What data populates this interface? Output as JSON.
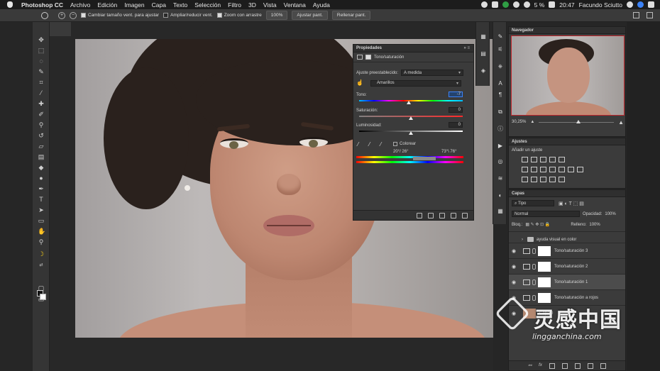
{
  "menubar": {
    "app_name": "Photoshop CC",
    "items": [
      "Archivo",
      "Edición",
      "Imagen",
      "Capa",
      "Texto",
      "Selección",
      "Filtro",
      "3D",
      "Vista",
      "Ventana",
      "Ayuda"
    ],
    "battery": "5 %",
    "time": "20:47",
    "user": "Facundo Sciutto"
  },
  "optionsbar": {
    "zoom_in": "+",
    "zoom_out": "−",
    "resize_windows": "Cambiar tamaño vent. para ajustar",
    "zoom_all_windows": "Ampliar/reducir vent.",
    "scrubby_zoom": "Zoom con arrastre",
    "percent_btn": "100%",
    "fit_btn": "Ajustar pant.",
    "fill_btn": "Rellenar pant."
  },
  "properties": {
    "title": "Propiedades",
    "panel_controls": "» ≡",
    "adjustment_name": "Tono/saturación",
    "preset_label": "Ajuste preestablecido:",
    "preset_value": "A medida",
    "channel_value": "Amarillos",
    "hue_label": "Tono:",
    "hue_value": "-7",
    "saturation_label": "Saturación:",
    "saturation_value": "0",
    "lightness_label": "Luminosidad:",
    "lightness_value": "0",
    "colorize_label": "Colorear",
    "range_left": "20°/ 26°",
    "range_right": "73°\\ 76°",
    "hue_level": 0.48,
    "saturation_level": 0.5,
    "lightness_level": 0.5
  },
  "navigator": {
    "title": "Navegador",
    "zoom": "30,25%"
  },
  "adjustments": {
    "title": "Ajustes",
    "subtitle": "Añadir un ajuste"
  },
  "layers": {
    "title": "Capas",
    "filter_kind": "Tipo",
    "blend_mode": "Normal",
    "opacity_label": "Opacidad:",
    "opacity_value": "100%",
    "lock_label": "Bloq.:",
    "fill_label": "Relleno:",
    "fill_value": "100%",
    "rows": [
      {
        "name": "ayuda visual en color",
        "type": "group"
      },
      {
        "name": "Tono/saturación 3",
        "type": "adjustment",
        "mask": "white"
      },
      {
        "name": "Tono/saturación 2",
        "type": "adjustment",
        "mask": "white"
      },
      {
        "name": "Tono/saturación 1",
        "type": "adjustment",
        "mask": "white"
      },
      {
        "name": "Tono/saturación  a rojos",
        "type": "adjustment",
        "mask": "white"
      },
      {
        "name": "Capa 0",
        "type": "pixel"
      }
    ],
    "footer": "fx"
  },
  "watermark": {
    "cn": "灵感中国",
    "url": "lingganchina.com"
  },
  "colors": {
    "accent": "#3b82f6",
    "panel": "#3b3b3b",
    "navigator_frame": "#c1272d"
  },
  "icons": [
    "apple-icon",
    "zoom-tool-icon",
    "move-tool-icon",
    "marquee-tool-icon",
    "lasso-tool-icon",
    "crop-tool-icon",
    "eyedropper-icon",
    "brush-icon",
    "eye-icon",
    "folder-icon",
    "chain-link-icon"
  ]
}
